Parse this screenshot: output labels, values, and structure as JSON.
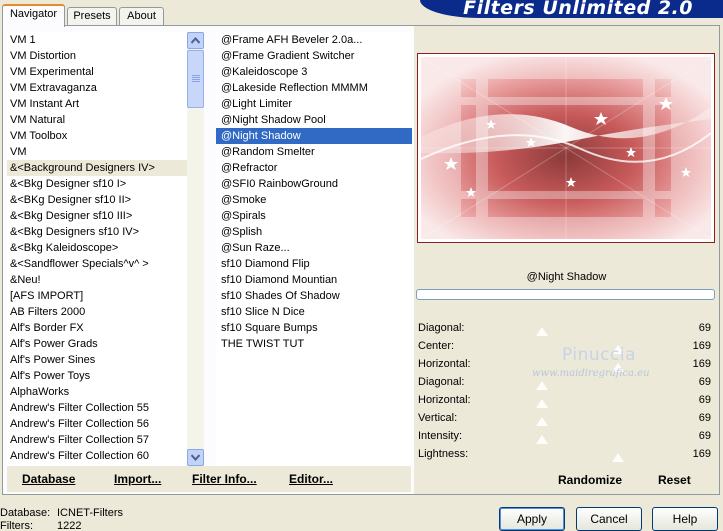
{
  "app": {
    "title": "Filters Unlimited 2.0",
    "tabs": [
      "Navigator",
      "Presets",
      "About"
    ]
  },
  "categories": [
    "VM 1",
    "VM Distortion",
    "VM Experimental",
    "VM Extravaganza",
    "VM Instant Art",
    "VM Natural",
    "VM Toolbox",
    "VM",
    "&<Background Designers IV>",
    "&<Bkg Designer sf10 I>",
    "&<BKg Designer sf10 II>",
    "&<Bkg Designer sf10 III>",
    "&<Bkg Designers sf10 IV>",
    "&<Bkg Kaleidoscope>",
    "&<Sandflower Specials^v^ >",
    "&Neu!",
    "[AFS IMPORT]",
    "AB Filters 2000",
    "Alf's Border FX",
    "Alf's Power Grads",
    "Alf's Power Sines",
    "Alf's Power Toys",
    "AlphaWorks",
    "Andrew's Filter Collection 55",
    "Andrew's Filter Collection 56",
    "Andrew's Filter Collection 57",
    "Andrew's Filter Collection 60"
  ],
  "selected_category": "&<Background Designers IV>",
  "filters": [
    "@Frame AFH Beveler 2.0a...",
    "@Frame Gradient Switcher",
    "@Kaleidoscope 3",
    "@Lakeside Reflection MMMM",
    "@Light Limiter",
    "@Night Shadow Pool",
    "@Night Shadow",
    "@Random Smelter",
    "@Refractor",
    "@SFI0 RainbowGround",
    "@Smoke",
    "@Spirals",
    "@Splish",
    "@Sun Raze...",
    "sf10 Diamond Flip",
    "sf10 Diamond Mountian",
    "sf10 Shades Of Shadow",
    "sf10 Slice N Dice",
    "sf10 Square Bumps",
    "THE TWIST TUT"
  ],
  "selected_filter": "@Night Shadow",
  "preview": {
    "filter_name": "@Night Shadow"
  },
  "params": [
    {
      "label": "Diagonal:",
      "value": "69",
      "fraction": 0.27
    },
    {
      "label": "Center:",
      "value": "169",
      "fraction": 0.66
    },
    {
      "label": "Horizontal:",
      "value": "169",
      "fraction": 0.66
    },
    {
      "label": "Diagonal:",
      "value": "69",
      "fraction": 0.27
    },
    {
      "label": "Horizontal:",
      "value": "69",
      "fraction": 0.27
    },
    {
      "label": "Vertical:",
      "value": "69",
      "fraction": 0.27
    },
    {
      "label": "Intensity:",
      "value": "69",
      "fraction": 0.27
    },
    {
      "label": "Lightness:",
      "value": "169",
      "fraction": 0.66
    }
  ],
  "watermark": {
    "name": "Pinuccia",
    "url": "www.maidiregrafica.eu"
  },
  "panel_buttons": {
    "database": "Database",
    "import": "Import...",
    "filter_info": "Filter Info...",
    "editor": "Editor...",
    "randomize": "Randomize",
    "reset": "Reset"
  },
  "status": {
    "database_label": "Database:",
    "database_value": "ICNET-Filters",
    "filters_label": "Filters:",
    "filters_value": "1222"
  },
  "dialog_buttons": {
    "apply": "Apply",
    "cancel": "Cancel",
    "help": "Help"
  },
  "colors": {
    "selection": "#316ac5",
    "banner": "#0a2a8c",
    "tab_accent": "#e68b2c"
  }
}
